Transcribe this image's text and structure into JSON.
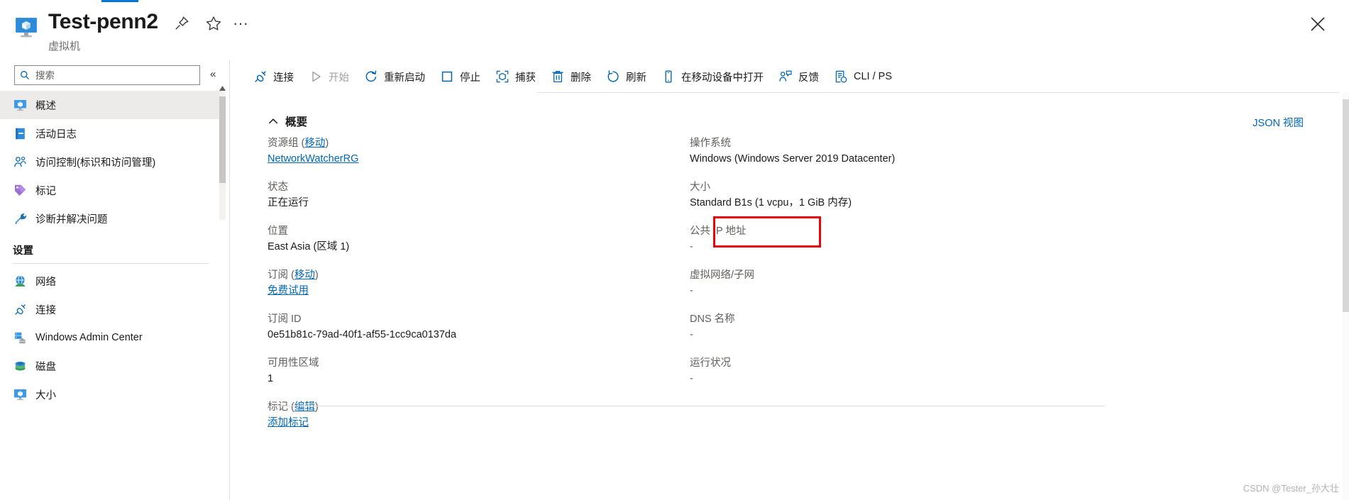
{
  "header": {
    "title": "Test-penn2",
    "subtitle": "虚拟机",
    "icon": "virtual-machine-icon",
    "actions": {
      "pin": "固定",
      "favorite": "收藏",
      "more": "···",
      "close": "关闭"
    }
  },
  "sidebar": {
    "search": {
      "placeholder": "搜索",
      "value": "",
      "icon": "search-icon"
    },
    "collapse_label": "«",
    "items": [
      {
        "label": "概述",
        "icon": "overview-vm-icon",
        "selected": true
      },
      {
        "label": "活动日志",
        "icon": "activity-log-icon",
        "selected": false
      },
      {
        "label": "访问控制(标识和访问管理)",
        "icon": "access-control-icon",
        "selected": false
      },
      {
        "label": "标记",
        "icon": "tag-icon",
        "selected": false
      },
      {
        "label": "诊断并解决问题",
        "icon": "diagnose-icon",
        "selected": false
      }
    ],
    "group_title": "设置",
    "settings_items": [
      {
        "label": "网络",
        "icon": "network-icon"
      },
      {
        "label": "连接",
        "icon": "connect-icon"
      },
      {
        "label": "Windows Admin Center",
        "icon": "admin-center-icon"
      },
      {
        "label": "磁盘",
        "icon": "disk-icon"
      },
      {
        "label": "大小",
        "icon": "size-vm-icon"
      }
    ]
  },
  "toolbar": {
    "buttons": [
      {
        "label": "连接",
        "icon": "connect-icon",
        "disabled": false
      },
      {
        "label": "开始",
        "icon": "play-icon",
        "disabled": true
      },
      {
        "label": "重新启动",
        "icon": "restart-icon",
        "disabled": false
      },
      {
        "label": "停止",
        "icon": "stop-icon",
        "disabled": false
      },
      {
        "label": "捕获",
        "icon": "capture-icon",
        "disabled": false
      },
      {
        "label": "删除",
        "icon": "delete-icon",
        "disabled": false
      },
      {
        "label": "刷新",
        "icon": "refresh-icon",
        "disabled": false
      },
      {
        "label": "在移动设备中打开",
        "icon": "mobile-icon",
        "disabled": false
      },
      {
        "label": "反馈",
        "icon": "feedback-icon",
        "disabled": false
      },
      {
        "label": "CLI / PS",
        "icon": "cli-ps-icon",
        "disabled": false
      }
    ]
  },
  "overview": {
    "section_title": "概要",
    "collapse_icon": "chevron-up-icon",
    "json_view_link": "JSON 视图",
    "left_fields": [
      {
        "label_main": "资源组",
        "label_link": "移动",
        "value": "NetworkWatcherRG",
        "value_is_link": true
      },
      {
        "label_main": "状态",
        "label_link": "",
        "value": "正在运行",
        "value_is_link": false
      },
      {
        "label_main": "位置",
        "label_link": "",
        "value": "East Asia (区域 1)",
        "value_is_link": false
      },
      {
        "label_main": "订阅",
        "label_link": "移动",
        "value": "免费试用",
        "value_is_link": true
      },
      {
        "label_main": "订阅 ID",
        "label_link": "",
        "value": "0e51b81c-79ad-40f1-af55-1cc9ca0137da",
        "value_is_link": false
      },
      {
        "label_main": "可用性区域",
        "label_link": "",
        "value": "1",
        "value_is_link": false
      },
      {
        "label_main": "标记",
        "label_link": "编辑",
        "value": "添加标记",
        "value_is_link": true
      }
    ],
    "right_fields": [
      {
        "label_main": "操作系统",
        "value": "Windows (Windows Server 2019 Datacenter)",
        "dim": false,
        "highlighted": false
      },
      {
        "label_main": "大小",
        "value": "Standard B1s (1 vcpu，1 GiB 内存)",
        "dim": false,
        "highlighted": false
      },
      {
        "label_main": "公共 IP 地址",
        "value": "-",
        "dim": true,
        "highlighted": true
      },
      {
        "label_main": "虚拟网络/子网",
        "value": "-",
        "dim": true,
        "highlighted": false
      },
      {
        "label_main": "DNS 名称",
        "value": "-",
        "dim": true,
        "highlighted": false
      },
      {
        "label_main": "运行状况",
        "value": "-",
        "dim": true,
        "highlighted": false
      }
    ]
  },
  "annotation": {
    "color": "#e8050c",
    "target": "公共 IP 地址"
  },
  "watermark": "CSDN @Tester_孙大壮",
  "colors": {
    "accent": "#0078d4",
    "link": "#0067b8",
    "selected_bg": "#edebe9",
    "annotation_red": "#e8050c",
    "label_gray": "#605e5c"
  }
}
